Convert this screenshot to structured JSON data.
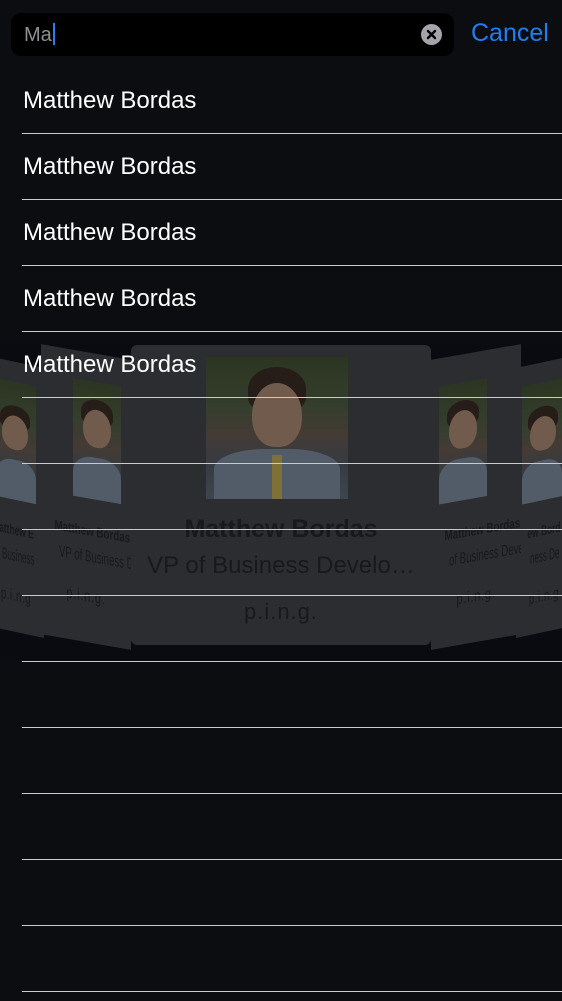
{
  "search": {
    "query": "Ma",
    "cancel_label": "Cancel"
  },
  "results": [
    {
      "name": "Matthew Bordas"
    },
    {
      "name": "Matthew Bordas"
    },
    {
      "name": "Matthew Bordas"
    },
    {
      "name": "Matthew Bordas"
    },
    {
      "name": "Matthew Bordas"
    },
    {
      "name": ""
    },
    {
      "name": ""
    },
    {
      "name": ""
    },
    {
      "name": ""
    },
    {
      "name": ""
    },
    {
      "name": ""
    },
    {
      "name": ""
    },
    {
      "name": ""
    },
    {
      "name": ""
    }
  ],
  "carousel": {
    "main_card": {
      "name": "Matthew Bordas",
      "title": "VP of Business Develo…",
      "logo": "p.i.n.g."
    },
    "side_card_left_1": {
      "name": "Matthew Bordas",
      "title": "VP of Business Devel",
      "logo": "p.i.n.g."
    },
    "side_card_left_2": {
      "name": "atthew E",
      "title": "Business",
      "logo": "p.i.n.g"
    },
    "side_card_right_1": {
      "name": "Matthew Bordas",
      "title": "of Business Develo…",
      "logo": "p.i.n.g."
    },
    "side_card_right_2": {
      "name": "ew Bord",
      "title": "ness De",
      "logo": "p.i.n.g"
    }
  },
  "colors": {
    "background": "#0b0d11",
    "accent": "#1e7ff0",
    "separator": "#c9cbcf",
    "row_text": "#ffffff",
    "placeholder_text": "#8d8f94"
  },
  "icons": {
    "clear": "clear-circle-x-icon"
  }
}
